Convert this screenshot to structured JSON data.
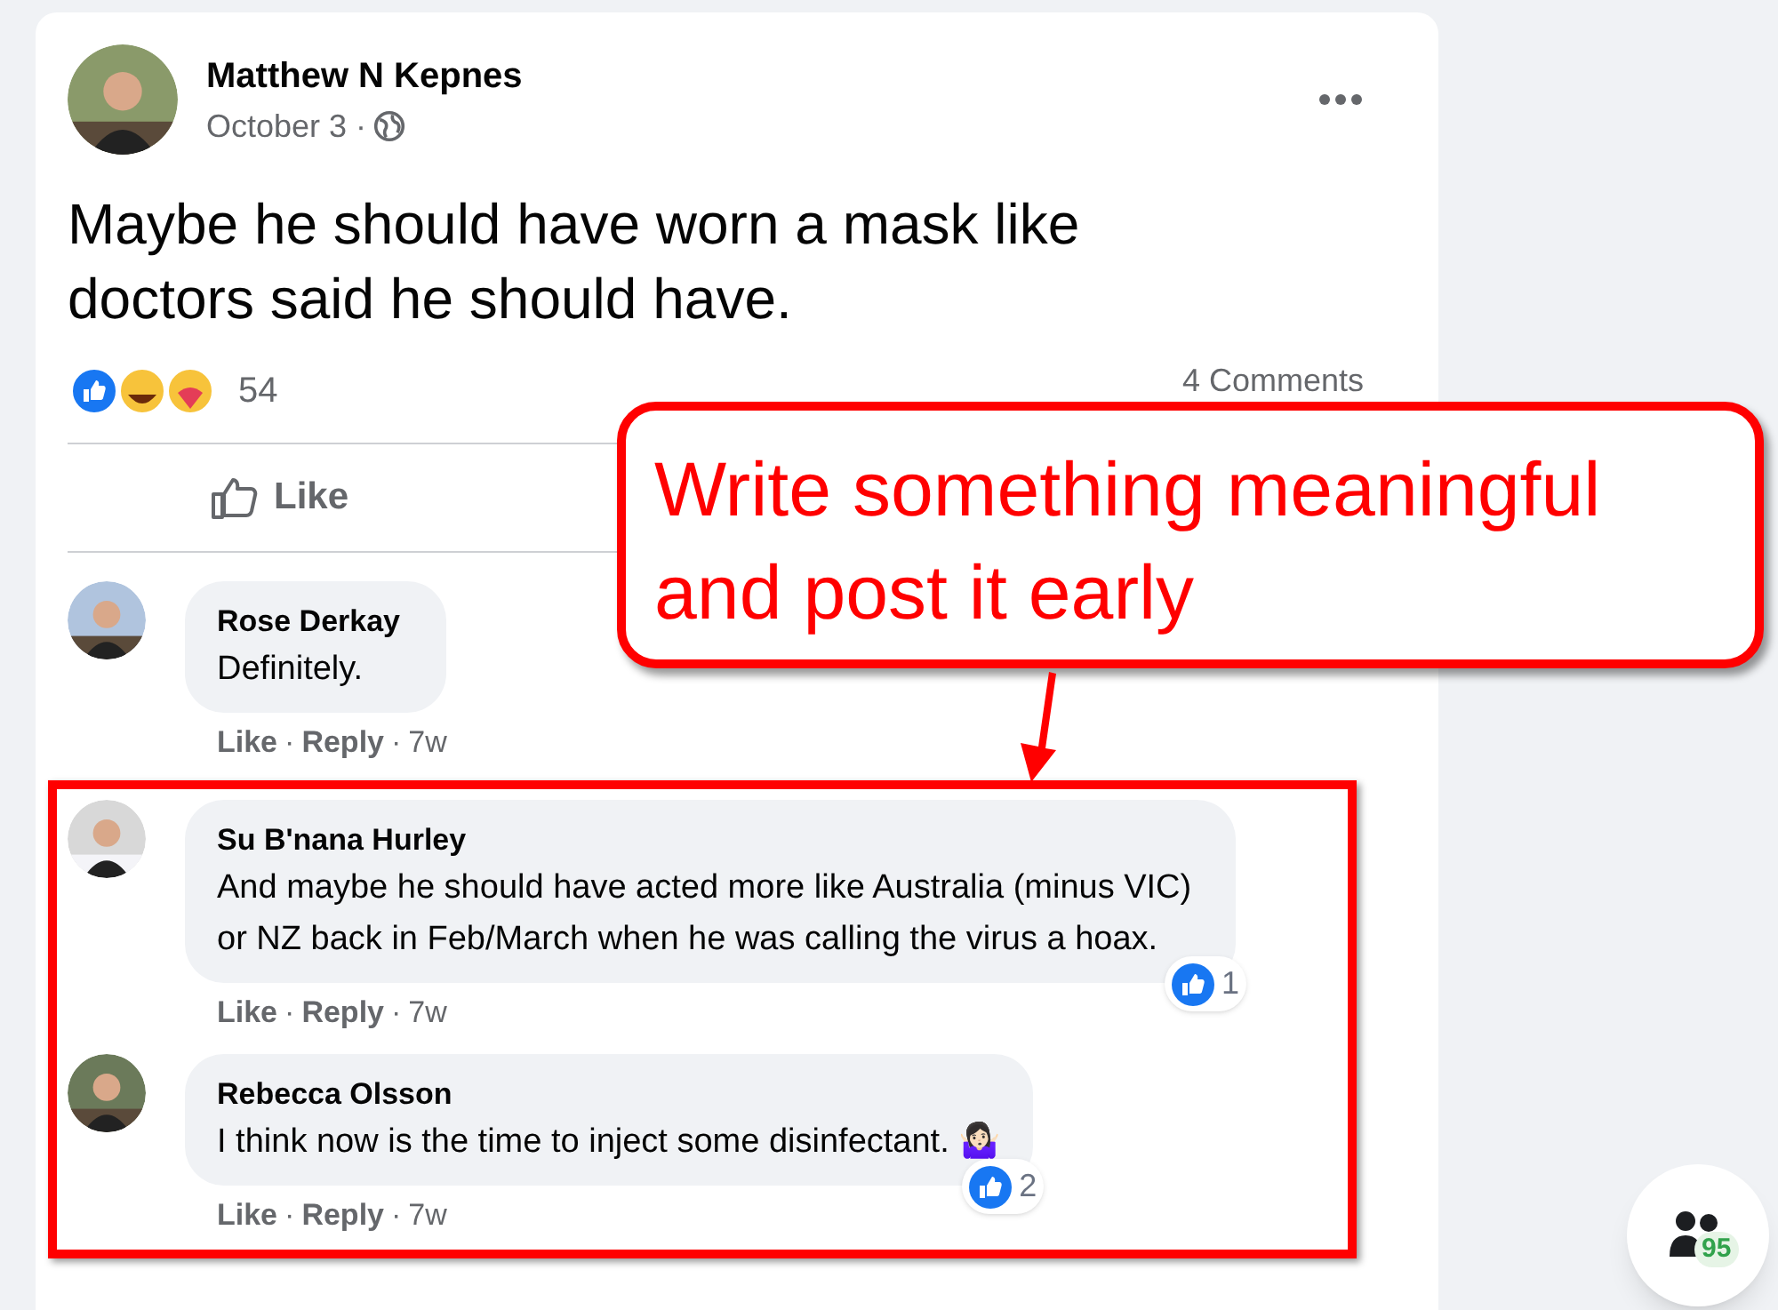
{
  "post": {
    "author": "Matthew N Kepnes",
    "date": "October 3 ·",
    "text": "Maybe he should have worn a mask like doctors said he should have.",
    "reaction_count": "54",
    "comments_count": "4 Comments",
    "actions": [
      {
        "label": "Like"
      }
    ]
  },
  "comments": [
    {
      "author": "Rose Derkay",
      "text": "Definitely.",
      "actions": [
        "Like",
        "Reply"
      ],
      "separator": "·",
      "age": "7w"
    }
  ],
  "highlighted_comments": [
    {
      "author": "Su B'nana Hurley",
      "text": "And maybe he should have acted more like Australia (minus VIC) or NZ back in Feb/March when he was calling the virus a hoax.",
      "actions": [
        "Like",
        "Reply"
      ],
      "separator": "·",
      "age": "7w",
      "likes": "1"
    },
    {
      "author": "Rebecca Olsson",
      "text": "I think now is the time to inject some disinfectant. 🤷🏻‍♀️",
      "actions": [
        "Like",
        "Reply"
      ],
      "separator": "·",
      "age": "7w",
      "likes": "2"
    }
  ],
  "callout": {
    "text": "Write something meaningful and post it early"
  },
  "contacts_button": {
    "count": "95"
  }
}
